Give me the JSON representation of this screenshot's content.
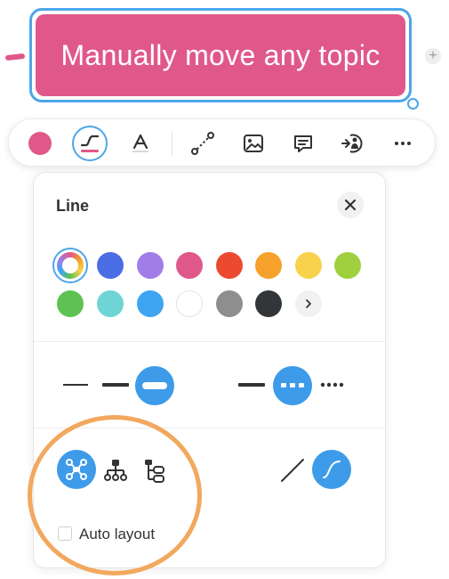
{
  "topic": {
    "text": "Manually move any topic",
    "color": "#e0588a",
    "selection_color": "#4da6ea"
  },
  "toolbar": {
    "items": [
      {
        "name": "topic-color",
        "icon": "color-dot-icon",
        "selected": false
      },
      {
        "name": "line-style",
        "icon": "line-curve-icon",
        "selected": true
      },
      {
        "name": "text-format",
        "icon": "text-format-icon",
        "selected": false
      },
      {
        "name": "relationship",
        "icon": "relationship-icon",
        "selected": false
      },
      {
        "name": "image",
        "icon": "image-icon",
        "selected": false
      },
      {
        "name": "comment",
        "icon": "comment-icon",
        "selected": false
      },
      {
        "name": "link",
        "icon": "link-icon",
        "selected": false
      },
      {
        "name": "more",
        "icon": "more-icon",
        "selected": false
      }
    ]
  },
  "panel": {
    "title": "Line",
    "colors": [
      "#4a6de5",
      "#a07de8",
      "#e0588a",
      "#ec4a2f",
      "#f5a12b",
      "#f8d24c",
      "#9fd13f",
      "#5ec252",
      "#6fd4d4",
      "#3ea4f2",
      "#ffffff",
      "#8e8e8e",
      "#333639"
    ],
    "thickness_options": [
      "thin",
      "medium",
      "thick"
    ],
    "thickness_selected": "thick",
    "dash_options": [
      "solid",
      "dashed",
      "dotted"
    ],
    "dash_selected": "dashed",
    "layout_options": [
      "map",
      "org-chart",
      "tree"
    ],
    "layout_selected": "map",
    "line_shape_options": [
      "straight",
      "curved"
    ],
    "line_shape_selected": "curved",
    "auto_layout_label": "Auto layout",
    "auto_layout_checked": false
  },
  "accent": "#3d9be9",
  "annotation_color": "#f2a85e"
}
